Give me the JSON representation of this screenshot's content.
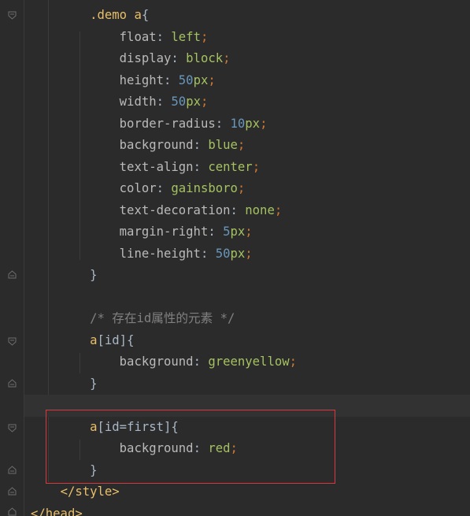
{
  "editor": {
    "lines": [
      {
        "indent": "",
        "parts": [
          {
            "t": "        .demo ",
            "c": "selector"
          },
          {
            "t": "a",
            "c": "selector"
          },
          {
            "t": "{",
            "c": "brace"
          }
        ]
      },
      {
        "parts": [
          {
            "t": "            ",
            "c": "plain"
          },
          {
            "t": "float",
            "c": "prop"
          },
          {
            "t": ": ",
            "c": "plain"
          },
          {
            "t": "left",
            "c": "val"
          },
          {
            "t": ";",
            "c": "punct"
          }
        ]
      },
      {
        "parts": [
          {
            "t": "            ",
            "c": "plain"
          },
          {
            "t": "display",
            "c": "prop"
          },
          {
            "t": ": ",
            "c": "plain"
          },
          {
            "t": "block",
            "c": "val"
          },
          {
            "t": ";",
            "c": "punct"
          }
        ]
      },
      {
        "parts": [
          {
            "t": "            ",
            "c": "plain"
          },
          {
            "t": "height",
            "c": "prop"
          },
          {
            "t": ": ",
            "c": "plain"
          },
          {
            "t": "50",
            "c": "num"
          },
          {
            "t": "px",
            "c": "unit"
          },
          {
            "t": ";",
            "c": "punct"
          }
        ]
      },
      {
        "parts": [
          {
            "t": "            ",
            "c": "plain"
          },
          {
            "t": "width",
            "c": "prop"
          },
          {
            "t": ": ",
            "c": "plain"
          },
          {
            "t": "50",
            "c": "num"
          },
          {
            "t": "px",
            "c": "unit"
          },
          {
            "t": ";",
            "c": "punct"
          }
        ]
      },
      {
        "parts": [
          {
            "t": "            ",
            "c": "plain"
          },
          {
            "t": "border-radius",
            "c": "prop"
          },
          {
            "t": ": ",
            "c": "plain"
          },
          {
            "t": "10",
            "c": "num"
          },
          {
            "t": "px",
            "c": "unit"
          },
          {
            "t": ";",
            "c": "punct"
          }
        ]
      },
      {
        "parts": [
          {
            "t": "            ",
            "c": "plain"
          },
          {
            "t": "background",
            "c": "prop"
          },
          {
            "t": ": ",
            "c": "plain"
          },
          {
            "t": "blue",
            "c": "val"
          },
          {
            "t": ";",
            "c": "punct"
          }
        ]
      },
      {
        "parts": [
          {
            "t": "            ",
            "c": "plain"
          },
          {
            "t": "text-align",
            "c": "prop"
          },
          {
            "t": ": ",
            "c": "plain"
          },
          {
            "t": "center",
            "c": "val"
          },
          {
            "t": ";",
            "c": "punct"
          }
        ]
      },
      {
        "parts": [
          {
            "t": "            ",
            "c": "plain"
          },
          {
            "t": "color",
            "c": "prop"
          },
          {
            "t": ": ",
            "c": "plain"
          },
          {
            "t": "gainsboro",
            "c": "val"
          },
          {
            "t": ";",
            "c": "punct"
          }
        ]
      },
      {
        "parts": [
          {
            "t": "            ",
            "c": "plain"
          },
          {
            "t": "text-decoration",
            "c": "prop"
          },
          {
            "t": ": ",
            "c": "plain"
          },
          {
            "t": "none",
            "c": "val"
          },
          {
            "t": ";",
            "c": "punct"
          }
        ]
      },
      {
        "parts": [
          {
            "t": "            ",
            "c": "plain"
          },
          {
            "t": "margin-right",
            "c": "prop"
          },
          {
            "t": ": ",
            "c": "plain"
          },
          {
            "t": "5",
            "c": "num"
          },
          {
            "t": "px",
            "c": "unit"
          },
          {
            "t": ";",
            "c": "punct"
          }
        ]
      },
      {
        "parts": [
          {
            "t": "            ",
            "c": "plain"
          },
          {
            "t": "line-height",
            "c": "prop"
          },
          {
            "t": ": ",
            "c": "plain"
          },
          {
            "t": "50",
            "c": "num"
          },
          {
            "t": "px",
            "c": "unit"
          },
          {
            "t": ";",
            "c": "punct"
          }
        ]
      },
      {
        "parts": [
          {
            "t": "        ",
            "c": "plain"
          },
          {
            "t": "}",
            "c": "brace"
          }
        ]
      },
      {
        "parts": []
      },
      {
        "parts": [
          {
            "t": "        ",
            "c": "plain"
          },
          {
            "t": "/* 存在id属性的元素 */",
            "c": "comment"
          }
        ]
      },
      {
        "parts": [
          {
            "t": "        ",
            "c": "plain"
          },
          {
            "t": "a",
            "c": "selector"
          },
          {
            "t": "[",
            "c": "brace"
          },
          {
            "t": "id",
            "c": "attr"
          },
          {
            "t": "]",
            "c": "brace"
          },
          {
            "t": "{",
            "c": "brace"
          }
        ]
      },
      {
        "parts": [
          {
            "t": "            ",
            "c": "plain"
          },
          {
            "t": "background",
            "c": "prop"
          },
          {
            "t": ": ",
            "c": "plain"
          },
          {
            "t": "greenyellow",
            "c": "val"
          },
          {
            "t": ";",
            "c": "punct"
          }
        ]
      },
      {
        "parts": [
          {
            "t": "        ",
            "c": "plain"
          },
          {
            "t": "}",
            "c": "brace"
          }
        ]
      },
      {
        "parts": [],
        "current": true
      },
      {
        "parts": [
          {
            "t": "        ",
            "c": "plain"
          },
          {
            "t": "a",
            "c": "selector"
          },
          {
            "t": "[",
            "c": "brace"
          },
          {
            "t": "id",
            "c": "attr"
          },
          {
            "t": "=",
            "c": "plain"
          },
          {
            "t": "first",
            "c": "attr"
          },
          {
            "t": "]",
            "c": "brace"
          },
          {
            "t": "{",
            "c": "brace"
          }
        ]
      },
      {
        "parts": [
          {
            "t": "            ",
            "c": "plain"
          },
          {
            "t": "background",
            "c": "prop"
          },
          {
            "t": ": ",
            "c": "plain"
          },
          {
            "t": "red",
            "c": "val"
          },
          {
            "t": ";",
            "c": "punct"
          }
        ]
      },
      {
        "parts": [
          {
            "t": "        ",
            "c": "plain"
          },
          {
            "t": "}",
            "c": "brace"
          }
        ]
      },
      {
        "parts": [
          {
            "t": "    ",
            "c": "plain"
          },
          {
            "t": "</style>",
            "c": "tag"
          }
        ]
      },
      {
        "parts": [
          {
            "t": "</head>",
            "c": "tag"
          }
        ]
      }
    ]
  },
  "colors": {
    "background": "#2b2b2b",
    "highlight_box": "#d9383e",
    "selector": "#e8bf6a",
    "value": "#a5c261",
    "number": "#6897bb",
    "punctuation": "#cc7832",
    "comment": "#808080"
  }
}
